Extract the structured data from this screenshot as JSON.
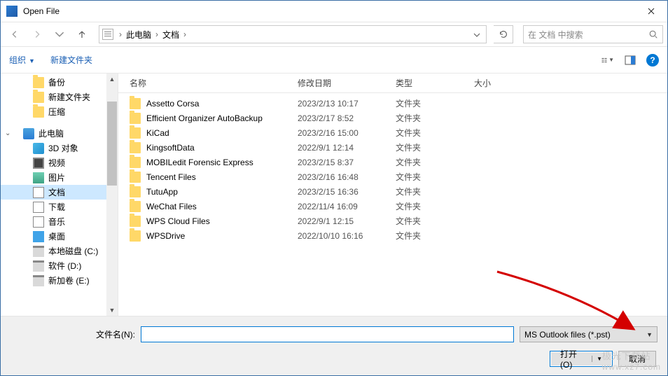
{
  "title": "Open File",
  "breadcrumbs": {
    "root": "此电脑",
    "folder": "文档"
  },
  "search": {
    "placeholder": "在 文档 中搜索"
  },
  "toolbar": {
    "organize": "组织",
    "newfolder": "新建文件夹"
  },
  "columns": {
    "name": "名称",
    "date": "修改日期",
    "type": "类型",
    "size": "大小"
  },
  "sidebar": {
    "items": [
      {
        "label": "备份",
        "icon": "folder",
        "lvl": 1
      },
      {
        "label": "新建文件夹",
        "icon": "folder",
        "lvl": 1
      },
      {
        "label": "压缩",
        "icon": "folder",
        "lvl": 1
      },
      {
        "label": "此电脑",
        "icon": "pc",
        "lvl": 0,
        "expandable": true
      },
      {
        "label": "3D 对象",
        "icon": "obj3d",
        "lvl": 1
      },
      {
        "label": "视频",
        "icon": "video",
        "lvl": 1
      },
      {
        "label": "图片",
        "icon": "pic",
        "lvl": 1
      },
      {
        "label": "文档",
        "icon": "doc",
        "lvl": 1,
        "selected": true
      },
      {
        "label": "下载",
        "icon": "dl",
        "lvl": 1
      },
      {
        "label": "音乐",
        "icon": "music",
        "lvl": 1
      },
      {
        "label": "桌面",
        "icon": "desktop",
        "lvl": 1
      },
      {
        "label": "本地磁盘 (C:)",
        "icon": "disk",
        "lvl": 1
      },
      {
        "label": "软件 (D:)",
        "icon": "disk",
        "lvl": 1
      },
      {
        "label": "新加卷 (E:)",
        "icon": "disk",
        "lvl": 1
      }
    ]
  },
  "files": [
    {
      "name": "Assetto Corsa",
      "date": "2023/2/13 10:17",
      "type": "文件夹"
    },
    {
      "name": "Efficient Organizer AutoBackup",
      "date": "2023/2/17 8:52",
      "type": "文件夹"
    },
    {
      "name": "KiCad",
      "date": "2023/2/16 15:00",
      "type": "文件夹"
    },
    {
      "name": "KingsoftData",
      "date": "2022/9/1 12:14",
      "type": "文件夹"
    },
    {
      "name": "MOBILedit Forensic Express",
      "date": "2023/2/15 8:37",
      "type": "文件夹"
    },
    {
      "name": "Tencent Files",
      "date": "2023/2/16 16:48",
      "type": "文件夹"
    },
    {
      "name": "TutuApp",
      "date": "2023/2/15 16:36",
      "type": "文件夹"
    },
    {
      "name": "WeChat Files",
      "date": "2022/11/4 16:09",
      "type": "文件夹"
    },
    {
      "name": "WPS Cloud Files",
      "date": "2022/9/1 12:15",
      "type": "文件夹"
    },
    {
      "name": "WPSDrive",
      "date": "2022/10/10 16:16",
      "type": "文件夹"
    }
  ],
  "footer": {
    "filename_label": "文件名(N):",
    "filename_value": "",
    "filetype": "MS Outlook files (*.pst)",
    "open": "打开(O)",
    "cancel": "取消"
  },
  "watermark": {
    "line1": "极光下载站",
    "line2": "www.xz7.com"
  }
}
